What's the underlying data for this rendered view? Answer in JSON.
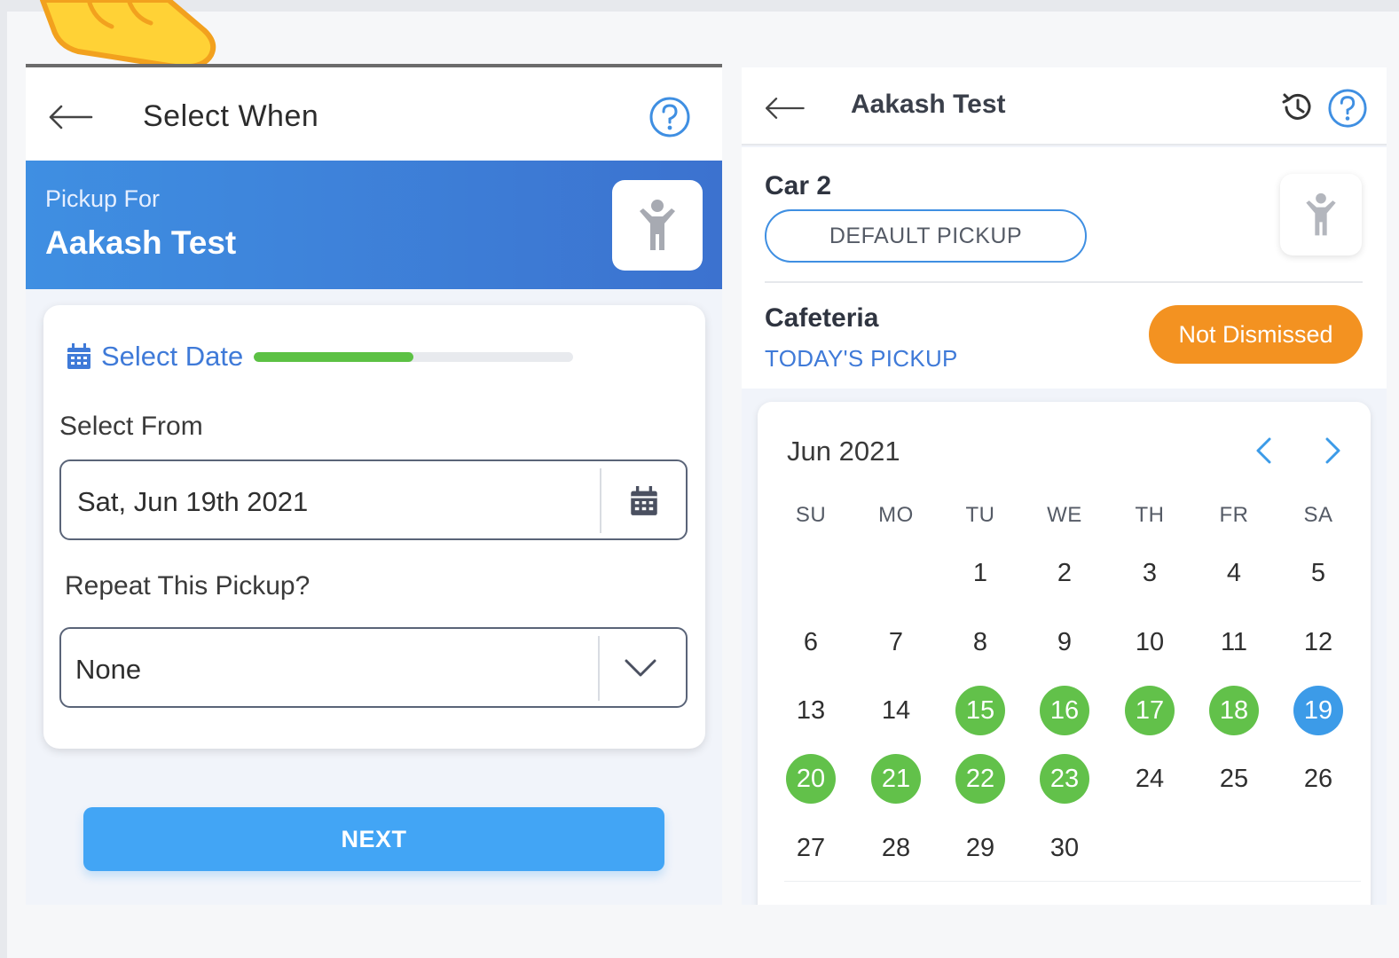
{
  "left": {
    "header": {
      "title": "Select When"
    },
    "banner": {
      "caption": "Pickup For",
      "name": "Aakash Test"
    },
    "card": {
      "step_label": "Select Date",
      "step_progress": 0.5,
      "from_label": "Select From",
      "from_value": "Sat, Jun 19th 2021",
      "repeat_label": "Repeat This Pickup?",
      "repeat_value": "None"
    },
    "next_label": "NEXT"
  },
  "right": {
    "header": {
      "title": "Aakash Test"
    },
    "car_label": "Car 2",
    "default_pickup_label": "DEFAULT PICKUP",
    "place_label": "Cafeteria",
    "today_label": "TODAY'S PICKUP",
    "status_label": "Not Dismissed",
    "calendar": {
      "month_label": "Jun 2021",
      "weekdays": [
        "SU",
        "MO",
        "TU",
        "WE",
        "TH",
        "FR",
        "SA"
      ],
      "first_weekday": 2,
      "days_in_month": 30,
      "green_days": [
        15,
        16,
        17,
        18,
        20,
        21,
        22,
        23
      ],
      "blue_days": [
        19
      ]
    }
  },
  "colors": {
    "accent_blue": "#3f7ad8",
    "button_blue": "#42a5f5",
    "progress_green": "#5cc144",
    "day_green": "#62c14a",
    "day_blue": "#3c9be8",
    "status_orange": "#f39221"
  },
  "icons": {
    "back": "arrow-left-icon",
    "help": "question-circle-icon",
    "history": "history-icon",
    "child": "child-icon",
    "calendar": "calendar-icon",
    "dropdown": "chevron-down-icon",
    "prev": "chevron-left-icon",
    "next": "chevron-right-icon",
    "pointer": "pointing-hand-icon"
  }
}
